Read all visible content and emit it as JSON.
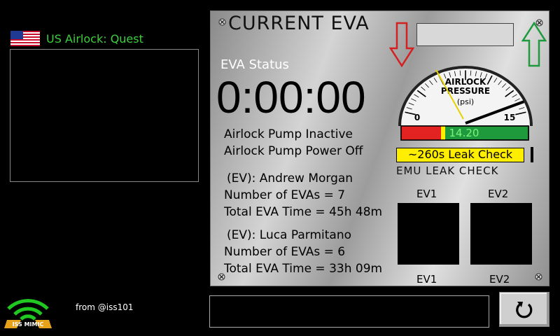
{
  "header": {
    "airlock_title": "US Airlock: Quest",
    "flag_icon": "us-flag-icon"
  },
  "panel": {
    "title": "CURRENT EVA",
    "eva_status_label": "EVA Status",
    "timer": "0:00:00",
    "status_lines": [
      "Airlock Pump Inactive",
      "Airlock Pump Power Off"
    ],
    "crew": [
      {
        "name": "(EV): Andrew Morgan",
        "evas": "Number of EVAs = 7",
        "time": "Total EVA Time = 45h 48m"
      },
      {
        "name": "(EV): Luca Parmitano",
        "evas": "Number of EVAs = 6",
        "time": "Total EVA Time = 33h 09m"
      }
    ],
    "gauge": {
      "title_line1": "AIRLOCK",
      "title_line2": "PRESSURE",
      "unit": "(psi)",
      "min_label": "0",
      "max_label": "15",
      "value": 14.2,
      "value_text": "14.20",
      "max": 15
    },
    "leak_check": "~260s Leak Check",
    "emu_label": "EMU LEAK CHECK",
    "ev_labels_top": [
      "EV1",
      "EV2"
    ],
    "ev_labels_bottom": [
      "EV1",
      "EV2"
    ]
  },
  "footer": {
    "from_text": "from @iss101",
    "logo_text": "ISS MIMIC"
  },
  "colors": {
    "panel_title": "#111111",
    "airlock_green": "#3dcf3d",
    "leak_yellow": "#ffee00",
    "bar_red": "#e32222",
    "bar_green": "#1e9a3c"
  }
}
